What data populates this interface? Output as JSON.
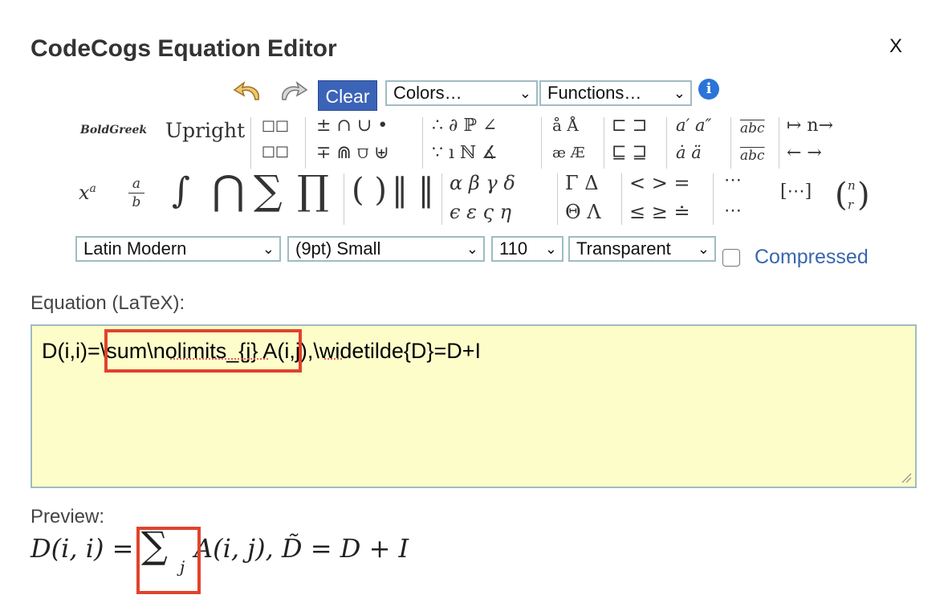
{
  "dialog": {
    "title": "CodeCogs Equation Editor",
    "close_label": "X"
  },
  "toolbar": {
    "undo_icon": "undo-icon",
    "redo_icon": "redo-icon",
    "clear_label": "Clear",
    "colors_label": "Colors…",
    "functions_label": "Functions…",
    "info_label": "i",
    "font_label": "Latin Modern",
    "size_label": "(9pt) Small",
    "dpi_label": "110",
    "background_label": "Transparent",
    "compressed_label": "Compressed",
    "compressed_checked": false,
    "accent_color": "#3b63b8"
  },
  "symbols": {
    "bold_greek": "BoldGreek",
    "upright": "Upright",
    "xa_base": "x",
    "xa_sup": "a",
    "frac_num": "a",
    "frac_den": "b",
    "integral": "∫",
    "bigcap": "⋂",
    "sum": "∑",
    "prod": "∏",
    "parens": "( )",
    "norms": "‖ ‖",
    "binops_top": "± ∩ ∪ •",
    "binops_bot": "∓ ⋒ ⩌ ⊎",
    "logic_top": "∴ ∂ ℙ ∠",
    "logic_bot": "∵ ı ℕ ∡",
    "accents_top": "å Å",
    "accents_bot": "æ Æ",
    "subset_top": "⊏ ⊐",
    "subset_bot": "⊑ ⊒",
    "primes_top": "a′ a″",
    "dots_bot": "ȧ ä",
    "wide_top": "abc",
    "wide_bot": "abc",
    "arrows_top": "↦ n→",
    "arrows_bot": "← →",
    "greek_top": "α β γ δ",
    "greek_bot": "ϵ ε ς η",
    "capgreek_top": "Γ Δ",
    "capgreek_bot": "Θ Λ",
    "rel_top": "< > =",
    "rel_bot": "≤ ≥ ≐",
    "dots": "⋯",
    "matrix": "[⋯]",
    "binom_top": "n",
    "binom_bot": "r"
  },
  "equation": {
    "label": "Equation (LaTeX):",
    "prefix": "D(i,i)=",
    "highlighted": "\\sum\\nolimits_{j}",
    "suffix": " A(i,j),\\widetilde{D}=D+I"
  },
  "preview": {
    "label": "Preview:",
    "lhs": "D(i, i) =",
    "sum_symbol": "∑",
    "sum_sub": "j",
    "rhs": "A(i, j), D̃ = D + I"
  },
  "colors": {
    "highlight": "#e0432b",
    "editor_bg": "#fdfdca",
    "link": "#3a66b0"
  }
}
